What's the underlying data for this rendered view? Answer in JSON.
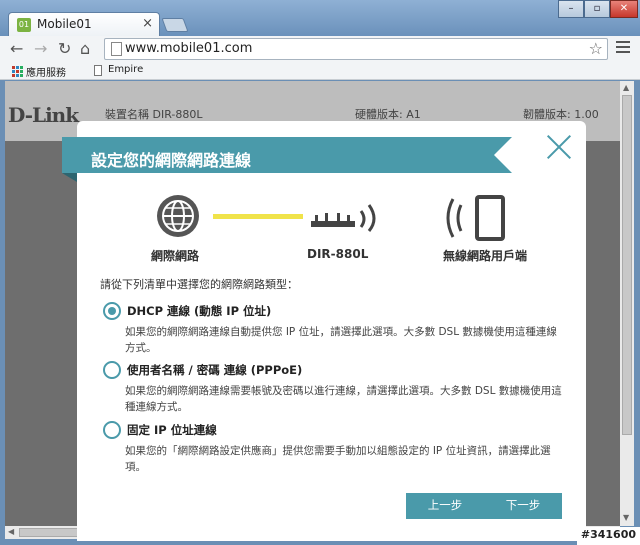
{
  "browser": {
    "tab_title": "Mobile01",
    "tab_favicon": "01",
    "tab_close": "×",
    "url": "www.mobile01.com",
    "bookmarks": [
      {
        "label": "應用服務"
      },
      {
        "label": "Empire"
      }
    ],
    "window_controls": {
      "minimize": "–",
      "maximize": "▫",
      "close": "✕"
    }
  },
  "device_header": {
    "logo": "D-Link",
    "device_name": "裝置名稱   DIR-880L",
    "hw_version": "硬體版本: A1",
    "fw_version": "韌體版本: 1.00"
  },
  "modal": {
    "title": "設定您的網際網路連線",
    "diagram": {
      "internet_label": "網際網路",
      "router_label": "DIR-880L",
      "client_label": "無線網路用戶端"
    },
    "intro": "請從下列清單中選擇您的網際網路類型：",
    "options": [
      {
        "label": "DHCP 連線 (動態 IP 位址)",
        "desc": "如果您的網際網路連線自動提供您 IP 位址，請選擇此選項。大多數 DSL 數據機使用這種連線方式。",
        "selected": true
      },
      {
        "label": "使用者名稱 / 密碼 連線 (PPPoE)",
        "desc": "如果您的網際網路連線需要帳號及密碼以進行連線，請選擇此選項。大多數 DSL 數據機使用這種連線方式。",
        "selected": false
      },
      {
        "label": "固定 IP 位址連線",
        "desc": "如果您的「網際網路設定供應商」提供您需要手動加以組態設定的 IP 位址資訊，請選擇此選項。",
        "selected": false
      }
    ],
    "buttons": {
      "prev": "上一步",
      "next": "下一步"
    }
  },
  "watermark": "#341600",
  "colors": {
    "accent": "#4a9aaa",
    "link_line": "#f0e34a"
  }
}
